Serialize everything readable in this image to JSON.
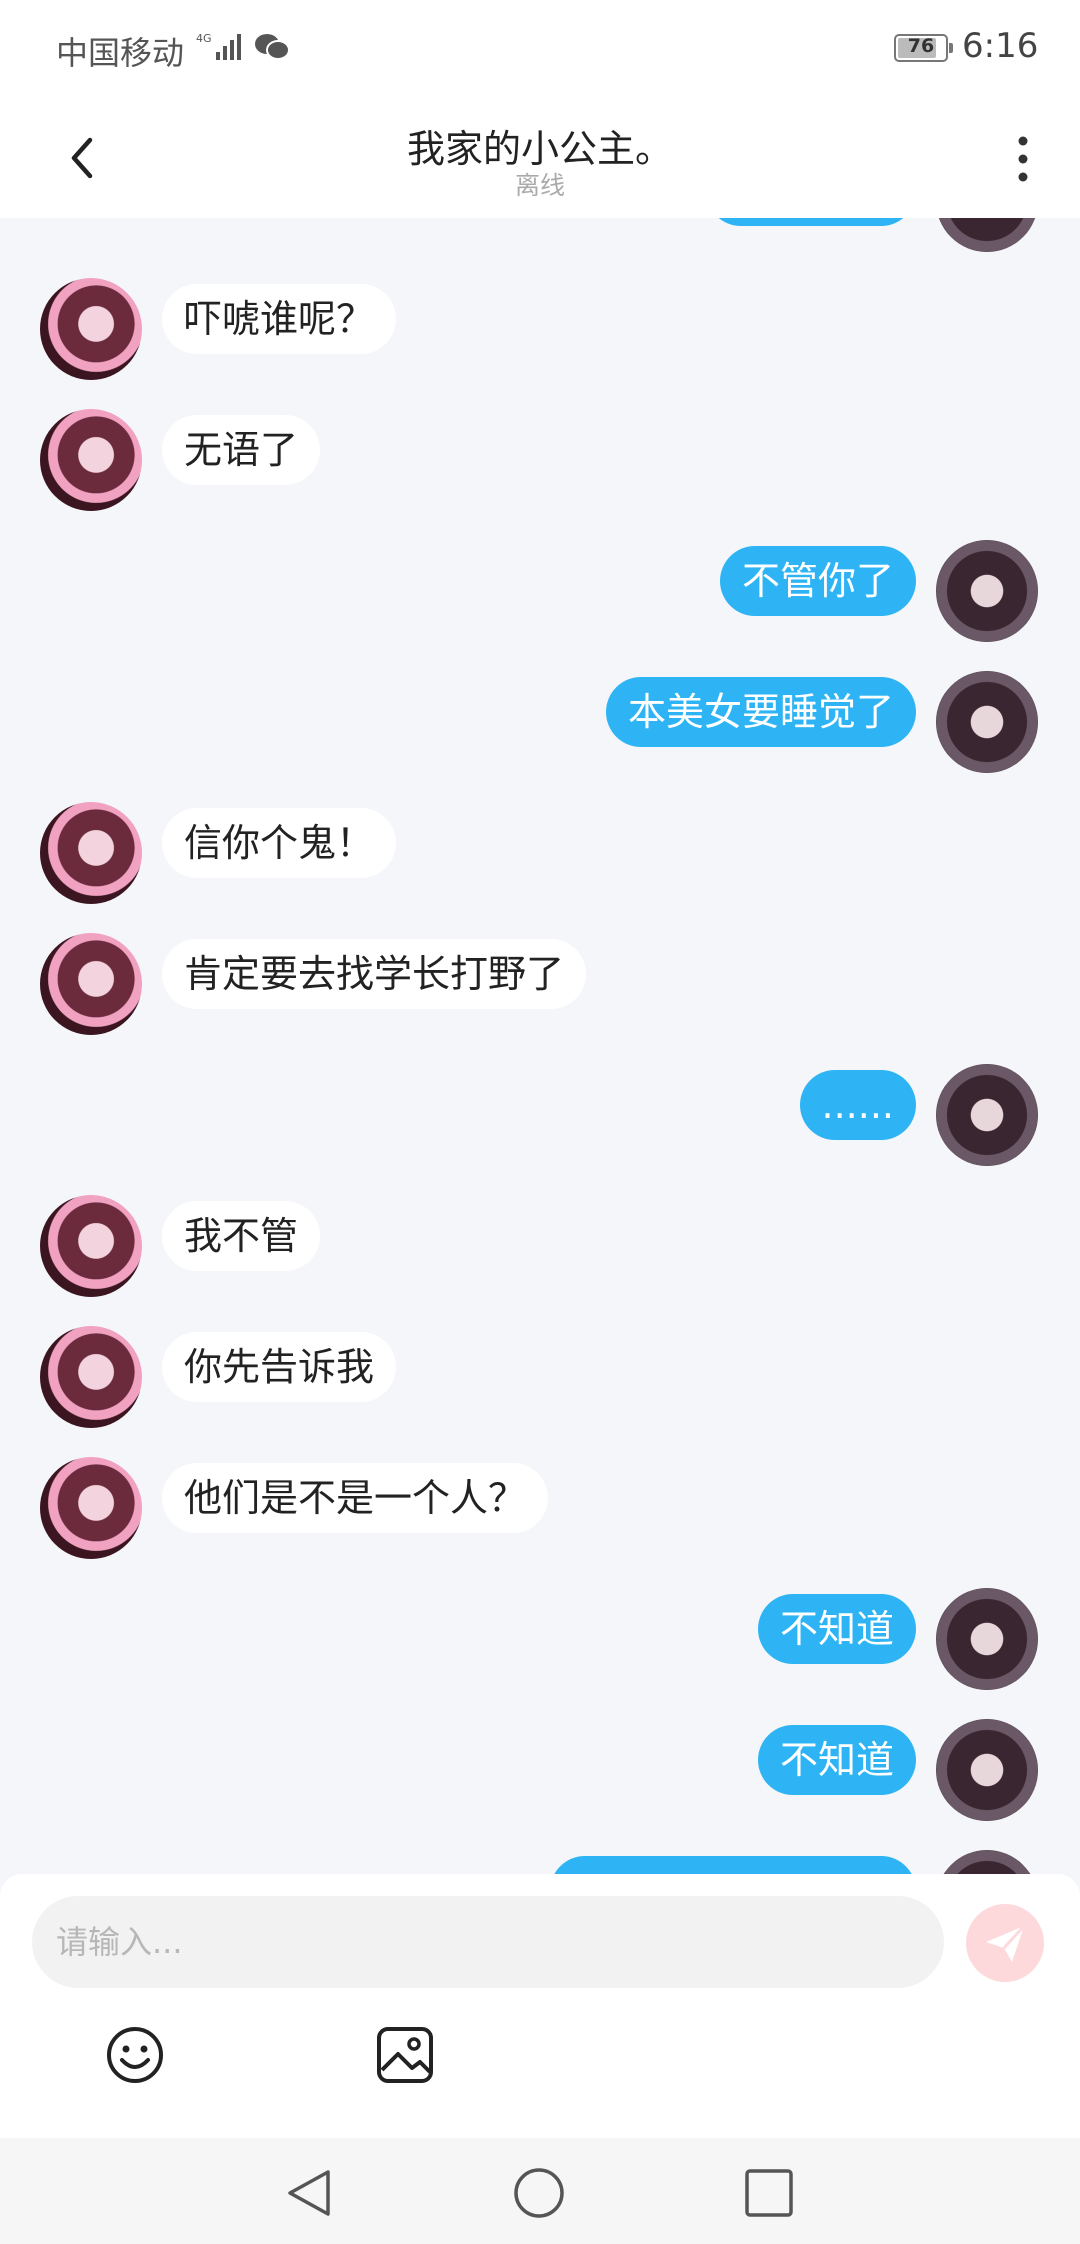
{
  "status_bar": {
    "carrier": "中国移动",
    "network": "4G",
    "battery": "76",
    "time": "6:16"
  },
  "header": {
    "title": "我家的小公主。",
    "subtitle": "离线"
  },
  "messages": [
    {
      "side": "left",
      "text": "吓唬谁呢？"
    },
    {
      "side": "left",
      "text": "无语了"
    },
    {
      "side": "right",
      "text": "不管你了"
    },
    {
      "side": "right",
      "text": "本美女要睡觉了"
    },
    {
      "side": "left",
      "text": "信你个鬼！"
    },
    {
      "side": "left",
      "text": "肯定要去找学长打野了"
    },
    {
      "side": "right",
      "text": "......"
    },
    {
      "side": "left",
      "text": "我不管"
    },
    {
      "side": "left",
      "text": "你先告诉我"
    },
    {
      "side": "left",
      "text": "他们是不是一个人？"
    },
    {
      "side": "right",
      "text": "不知道"
    },
    {
      "side": "right",
      "text": "不知道"
    }
  ],
  "composer": {
    "placeholder": "请输入..."
  },
  "colors": {
    "accent_blue": "#2eb4f4",
    "send_button": "#fdd9dc",
    "background": "#f4f6f9"
  },
  "icons": {
    "back": "chevron-left-icon",
    "more": "more-vertical-icon",
    "send": "send-icon",
    "emoji": "emoji-icon",
    "image": "image-icon"
  }
}
